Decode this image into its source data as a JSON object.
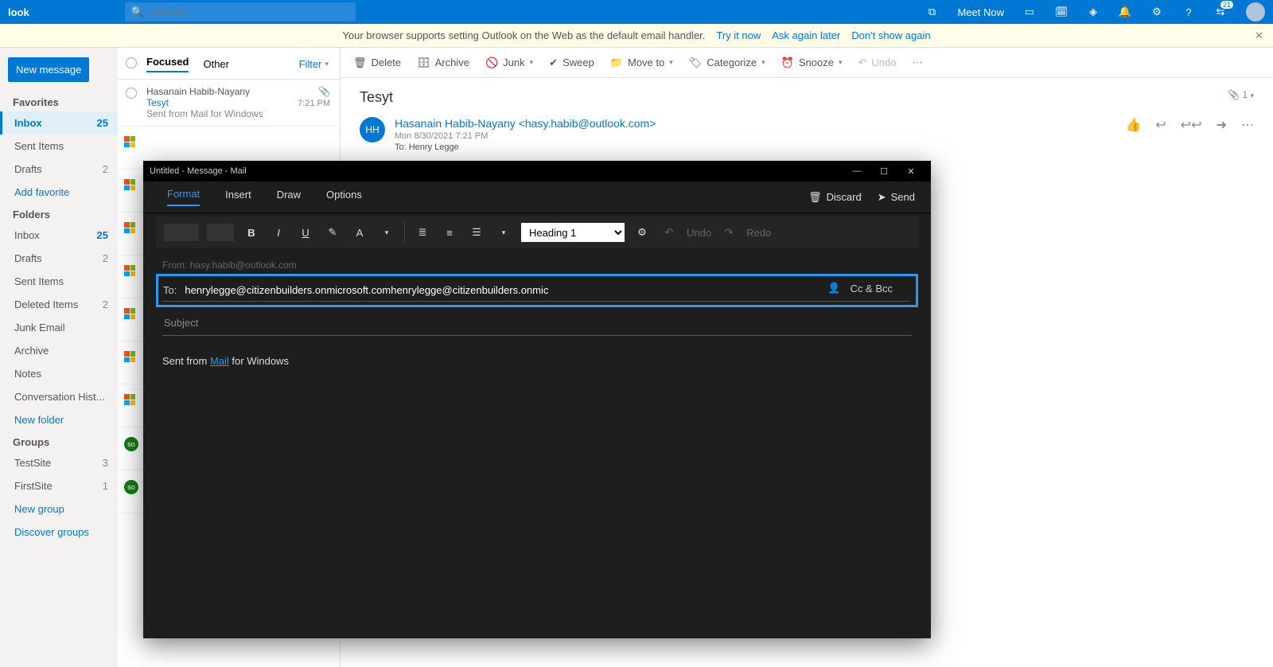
{
  "header": {
    "brand": "look",
    "search_placeholder": "Search",
    "meet_now": "Meet Now",
    "badge": "21"
  },
  "banner": {
    "text": "Your browser supports setting Outlook on the Web as the default email handler.",
    "try": "Try it now",
    "later": "Ask again later",
    "dont": "Don't show again"
  },
  "sidebar": {
    "new_msg": "New message",
    "favorites_label": "Favorites",
    "folders_label": "Folders",
    "groups_label": "Groups",
    "add_fav": "Add favorite",
    "new_folder": "New folder",
    "new_group": "New group",
    "discover": "Discover groups",
    "fav": [
      {
        "label": "Inbox",
        "count": "25"
      },
      {
        "label": "Sent Items",
        "count": ""
      },
      {
        "label": "Drafts",
        "count": "2"
      }
    ],
    "folders": [
      {
        "label": "Inbox",
        "count": "25"
      },
      {
        "label": "Drafts",
        "count": "2"
      },
      {
        "label": "Sent Items",
        "count": ""
      },
      {
        "label": "Deleted Items",
        "count": "2"
      },
      {
        "label": "Junk Email",
        "count": ""
      },
      {
        "label": "Archive",
        "count": ""
      },
      {
        "label": "Notes",
        "count": ""
      },
      {
        "label": "Conversation Hist...",
        "count": ""
      }
    ],
    "groups": [
      {
        "label": "TestSite",
        "count": "3"
      },
      {
        "label": "FirstSite",
        "count": "1"
      }
    ]
  },
  "msglist": {
    "focused": "Focused",
    "other": "Other",
    "filter": "Filter",
    "item0": {
      "from": "Hasanain Habib-Nayany",
      "subj": "Tesyt",
      "prev": "Sent from Mail for Windows",
      "time": "7:21 PM"
    }
  },
  "actions": {
    "delete": "Delete",
    "archive": "Archive",
    "junk": "Junk",
    "sweep": "Sweep",
    "move": "Move to",
    "categorize": "Categorize",
    "snooze": "Snooze",
    "undo": "Undo"
  },
  "reading": {
    "subject": "Tesyt",
    "attach": "1",
    "avatar": "HH",
    "from": "Hasanain Habib-Nayany <hasy.habib@outlook.com>",
    "date": "Mon 8/30/2021 7:21 PM",
    "to": "To:  Henry Legge"
  },
  "compose": {
    "title": "Untitled - Message - Mail",
    "tabs": {
      "format": "Format",
      "insert": "Insert",
      "draw": "Draw",
      "options": "Options"
    },
    "discard": "Discard",
    "send": "Send",
    "heading": "Heading 1",
    "undo": "Undo",
    "redo": "Redo",
    "from_label": "From:",
    "from_addr": "hasy.habib@outlook.com",
    "to_label": "To:",
    "to_value": "henrylegge@citizenbuilders.onmicrosoft.comhenrylegge@citizenbuilders.onmic",
    "ccbcc": "Cc & Bcc",
    "subject_ph": "Subject",
    "sent_from_pre": "Sent from ",
    "mail_link": "Mail",
    "sent_from_post": " for Windows"
  }
}
